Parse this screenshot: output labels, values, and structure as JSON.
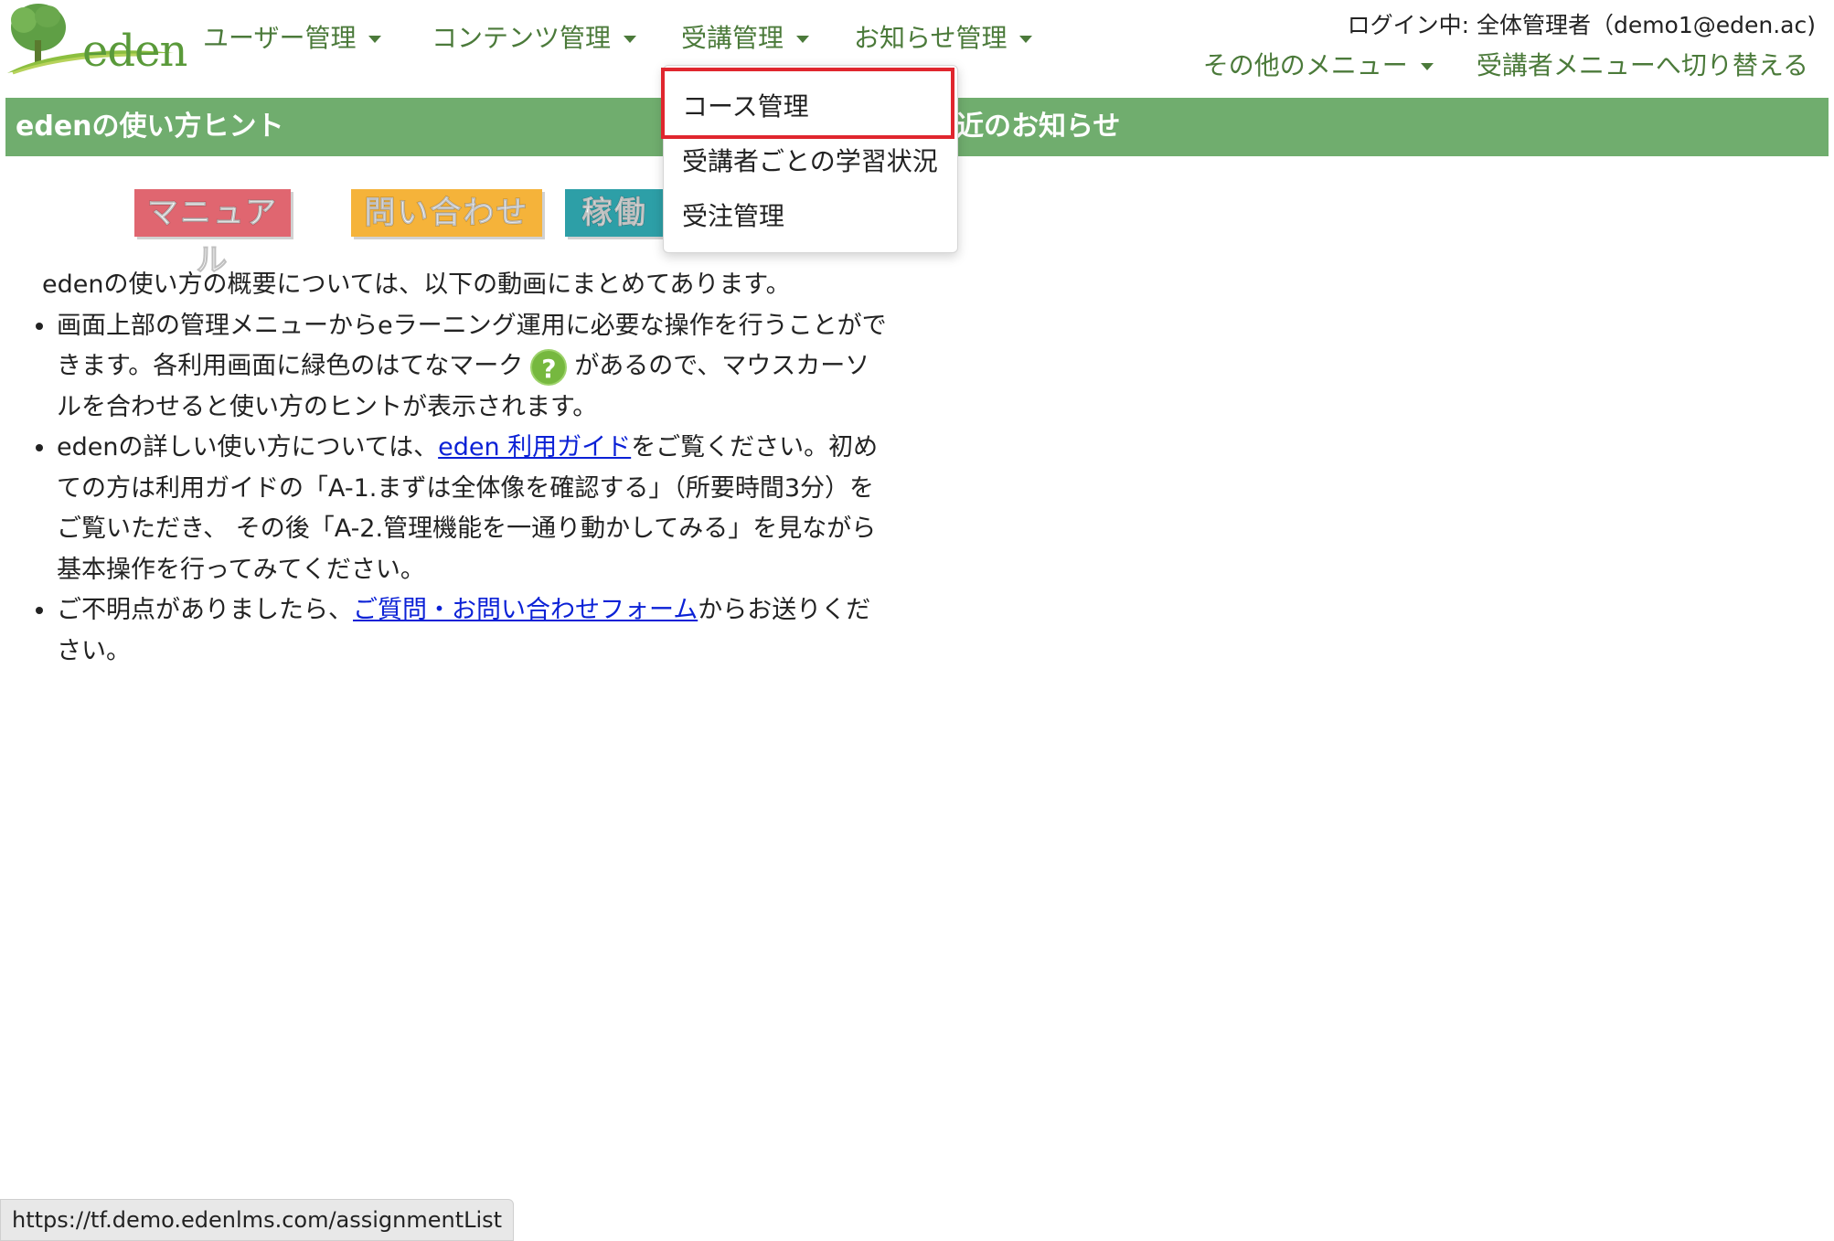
{
  "logo": {
    "text": "eden"
  },
  "nav": {
    "items": [
      {
        "label": "ユーザー管理"
      },
      {
        "label": "コンテンツ管理"
      },
      {
        "label": "受講管理"
      },
      {
        "label": "お知らせ管理"
      }
    ]
  },
  "header": {
    "login_info": "ログイン中: 全体管理者（demo1@eden.ac)",
    "other_menu": "その他のメニュー",
    "switch_menu": "受講者メニューへ切り替える"
  },
  "sections": {
    "hint_title": "edenの使い方ヒント",
    "news_title": "近のお知らせ"
  },
  "badges": {
    "manual": "マニュアル",
    "contact": "問い合わせ",
    "status": "稼働状況"
  },
  "content": {
    "intro": "edenの使い方の概要については、以下の動画にまとめてあります。",
    "bullet1_part1": "画面上部の管理メニューからeラーニング運用に必要な操作を行うことができます。各利用画面に緑色のはてなマーク",
    "help_mark": "?",
    "bullet1_part2": "があるので、マウスカーソルを合わせると使い方のヒントが表示されます。",
    "bullet2_part1": "edenの詳しい使い方については、",
    "bullet2_link": "eden 利用ガイド",
    "bullet2_part2": "をご覧ください。初めての方は利用ガイドの「A-1.まずは全体像を確認する」（所要時間3分）をご覧いただき、 その後「A-2.管理機能を一通り動かしてみる」を見ながら基本操作を行ってみてください。",
    "bullet3_part1": "ご不明点がありましたら、",
    "bullet3_link": "ご質問・お問い合わせフォーム",
    "bullet3_part2": "からお送りください。"
  },
  "dropdown": {
    "items": [
      {
        "label": "コース管理"
      },
      {
        "label": "受講者ごとの学習状況"
      },
      {
        "label": "受注管理"
      }
    ]
  },
  "status_bar": {
    "url": "https://tf.demo.edenlms.com/assignmentList"
  }
}
